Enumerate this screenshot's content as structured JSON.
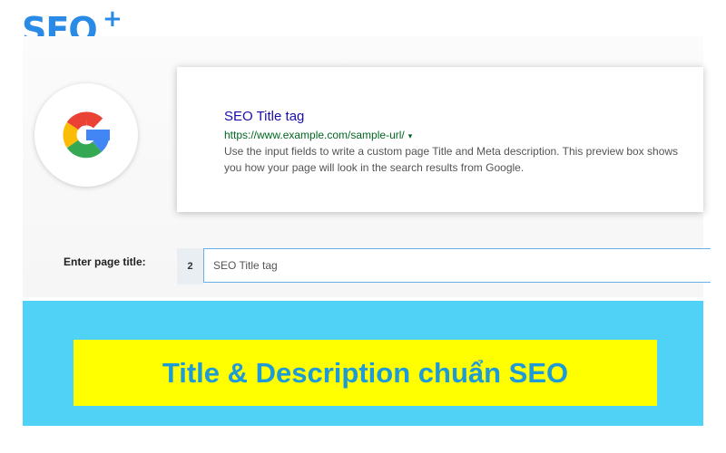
{
  "brand": {
    "name": "SEO",
    "plus": "+",
    "color": "#2a8be6"
  },
  "preview": {
    "title": "SEO Title tag",
    "url": "https://www.example.com/sample-url/",
    "url_caret": "▾",
    "description": "Use the input fields to write a custom page Title and Meta description. This preview box shows you how your page will look in the search results from Google."
  },
  "form": {
    "title_label": "Enter page title:",
    "title_counter": "2",
    "title_value": "SEO Title tag"
  },
  "banner": {
    "text": "Title & Description chuẩn SEO",
    "background": "#4fd2f6",
    "box_color": "#ffff00",
    "text_color": "#1e9ad6"
  },
  "icons": {
    "google": "google-g-icon"
  }
}
